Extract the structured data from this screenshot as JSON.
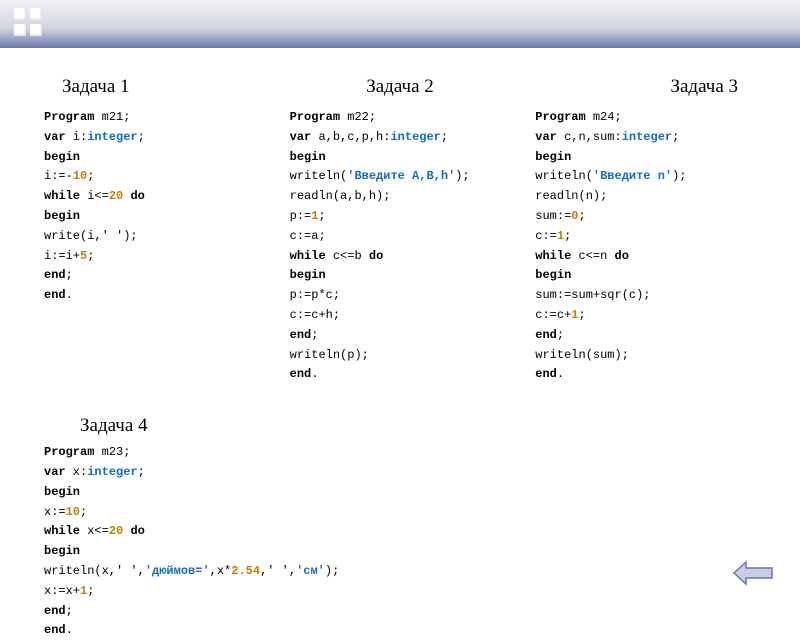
{
  "titles": {
    "t1": "Задача 1",
    "t2": "Задача 2",
    "t3": "Задача 3",
    "t4": "Задача 4"
  },
  "code1": {
    "l1a": "Program",
    "l1b": " m21;",
    "l2a": "var",
    "l2b": " i:",
    "l2c": "integer",
    "l2d": ";",
    "l3": "begin",
    "l4a": "i:=-",
    "l4b": "10",
    "l4c": ";",
    "l5a": "while",
    "l5b": " i<=",
    "l5c": "20",
    "l5d": " ",
    "l5e": "do",
    "l6": "begin",
    "l7": "write(i,' ');",
    "l8a": "i:=i+",
    "l8b": "5",
    "l8c": ";",
    "l9a": "end",
    "l9b": ";",
    "l10a": "end",
    "l10b": "."
  },
  "code2": {
    "l1a": "Program",
    "l1b": " m22;",
    "l2a": "var",
    "l2b": " a,b,c,p,h:",
    "l2c": "integer",
    "l2d": ";",
    "l3": "begin",
    "l4a": "writeln(",
    "l4b": "'Введите A,B,h'",
    "l4c": ");",
    "l5": "readln(a,b,h);",
    "l6a": "p:=",
    "l6b": "1",
    "l6c": ";",
    "l7": "c:=a;",
    "l8a": "while",
    "l8b": " c<=b ",
    "l8c": "do",
    "l9": "begin",
    "l10": "p:=p*c;",
    "l11": "c:=c+h;",
    "l12a": "end",
    "l12b": ";",
    "l13": "writeln(p);",
    "l14a": "end",
    "l14b": "."
  },
  "code3": {
    "l1a": "Program",
    "l1b": " m24;",
    "l2a": "var",
    "l2b": " c,n,sum:",
    "l2c": "integer",
    "l2d": ";",
    "l3": "begin",
    "l4a": "writeln(",
    "l4b": "'Введите n'",
    "l4c": ");",
    "l5": "readln(n);",
    "l6a": "sum:=",
    "l6b": "0",
    "l6c": ";",
    "l7a": "c:=",
    "l7b": "1",
    "l7c": ";",
    "l8a": "while",
    "l8b": " c<=n ",
    "l8c": "do",
    "l9": "begin",
    "l10": "sum:=sum+sqr(c);",
    "l11a": "c:=c+",
    "l11b": "1",
    "l11c": ";",
    "l12a": "end",
    "l12b": ";",
    "l13": "writeln(sum);",
    "l14a": "end",
    "l14b": "."
  },
  "code4": {
    "l1a": "Program",
    "l1b": " m23;",
    "l2a": "var",
    "l2b": " x:",
    "l2c": "integer",
    "l2d": ";",
    "l3": "begin",
    "l4a": "x:=",
    "l4b": "10",
    "l4c": ";",
    "l5a": "while",
    "l5b": " x<=",
    "l5c": "20",
    "l5d": " ",
    "l5e": "do",
    "l6": "begin",
    "l7a": "writeln(x,' ',",
    "l7b": "'дюймов='",
    "l7c": ",x*",
    "l7d": "2.54",
    "l7e": ",' ',",
    "l7f": "'см'",
    "l7g": ");",
    "l8a": "x:=x+",
    "l8b": "1",
    "l8c": ";",
    "l9a": "end",
    "l9b": ";",
    "l10a": "end",
    "l10b": "."
  },
  "nav_arrow_color": "#7a84b8"
}
